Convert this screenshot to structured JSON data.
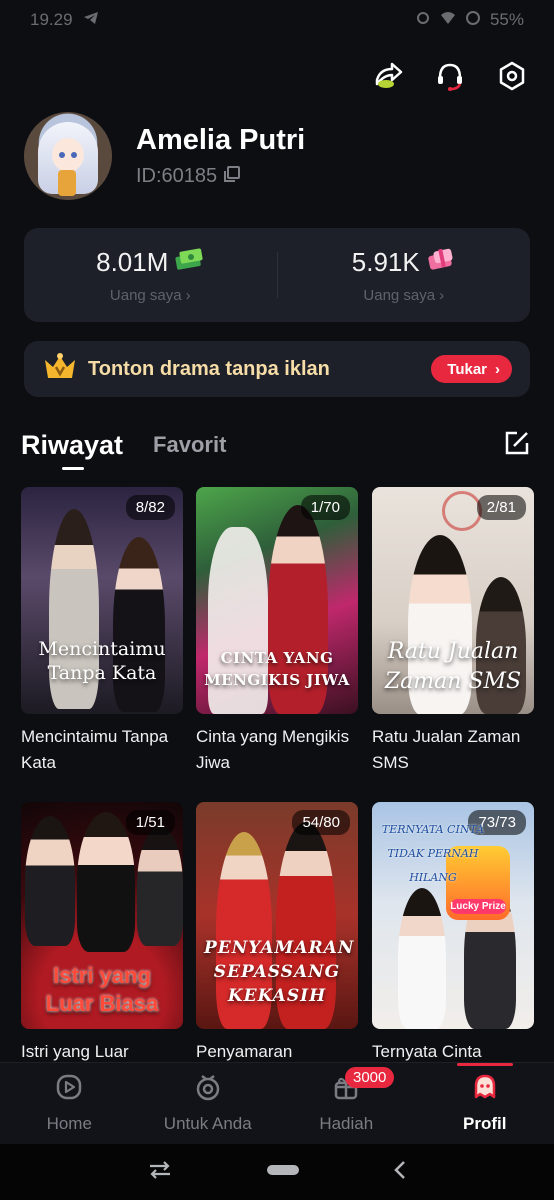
{
  "status_bar": {
    "time": "19.29",
    "battery": "55%"
  },
  "profile": {
    "name": "Amelia Putri",
    "id": "ID:60185"
  },
  "wallet": [
    {
      "value": "8.01M",
      "label": "Uang saya",
      "icon": "cash-icon"
    },
    {
      "value": "5.91K",
      "label": "Uang saya",
      "icon": "gift-coupon-icon"
    }
  ],
  "banner": {
    "text": "Tonton drama tanpa iklan",
    "button": "Tukar"
  },
  "tabs": {
    "active": "Riwayat",
    "other": "Favorit"
  },
  "dramas": [
    {
      "title": "Mencintaimu Tanpa Kata",
      "episodes": "8/82",
      "poster_text": "Mencintaimu Tanpa Kata"
    },
    {
      "title": "Cinta yang Mengikis Jiwa",
      "episodes": "1/70",
      "poster_text": "CINTA YANG MENGIKIS JIWA"
    },
    {
      "title": "Ratu Jualan Zaman SMS",
      "episodes": "2/81",
      "poster_text": "Ratu Jualan Zaman SMS"
    },
    {
      "title": "Istri yang Luar",
      "episodes": "1/51",
      "poster_text": "Istri yang Luar Biasa"
    },
    {
      "title": "Penyamaran",
      "episodes": "54/80",
      "poster_text": "PENYAMARAN SEPASSANG KEKASIH"
    },
    {
      "title": "Ternyata Cinta",
      "episodes": "73/73",
      "poster_text": "TERNYATA CINTA TIDAK PERNAH HILANG",
      "promo": "Lucky Prize"
    }
  ],
  "bottom_nav": [
    {
      "label": "Home",
      "icon": "play-circle-icon"
    },
    {
      "label": "Untuk Anda",
      "icon": "tv-icon"
    },
    {
      "label": "Hadiah",
      "icon": "gift-icon",
      "badge": "3000"
    },
    {
      "label": "Profil",
      "icon": "profile-ghost-icon",
      "active": true
    }
  ],
  "colors": {
    "accent": "#e8283f",
    "background": "#0d0e12",
    "card": "#1d2029",
    "banner_text": "#f6dca6"
  }
}
